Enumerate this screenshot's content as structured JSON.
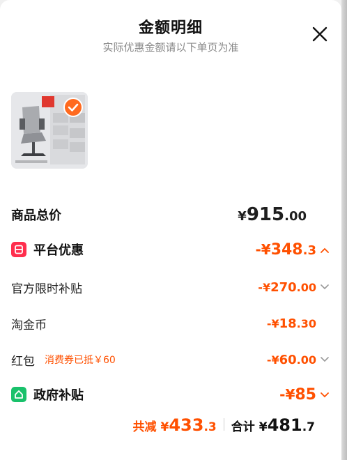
{
  "header": {
    "title": "金额明细",
    "subtitle": "实际优惠金额请以下单页为准"
  },
  "product": {
    "selected": true
  },
  "rows": {
    "total": {
      "label": "商品总价",
      "currency": "¥",
      "int": "915",
      "dec": ".00"
    },
    "platform": {
      "label": "平台优惠",
      "prefix": "-¥",
      "int": "348",
      "dec": ".3"
    },
    "official": {
      "label": "官方限时补贴",
      "prefix": "-¥",
      "int": "270",
      "dec": ".00"
    },
    "coin": {
      "label": "淘金币",
      "prefix": "-¥",
      "int": "18",
      "dec": ".30"
    },
    "redpacket": {
      "label": "红包",
      "hint": "消费券已抵￥60",
      "prefix": "-¥",
      "int": "60",
      "dec": ".00"
    },
    "gov": {
      "label": "政府补贴",
      "prefix": "-¥",
      "int": "85"
    }
  },
  "footer": {
    "saved_label": "共减",
    "saved_currency": "¥",
    "saved_int": "433",
    "saved_dec": ".3",
    "total_label": "合计",
    "total_currency": "¥",
    "total_int": "481",
    "total_dec": ".7"
  },
  "colors": {
    "accent": "#ff5000",
    "badge_red": "#ff2e4d",
    "badge_green": "#19c16b"
  }
}
